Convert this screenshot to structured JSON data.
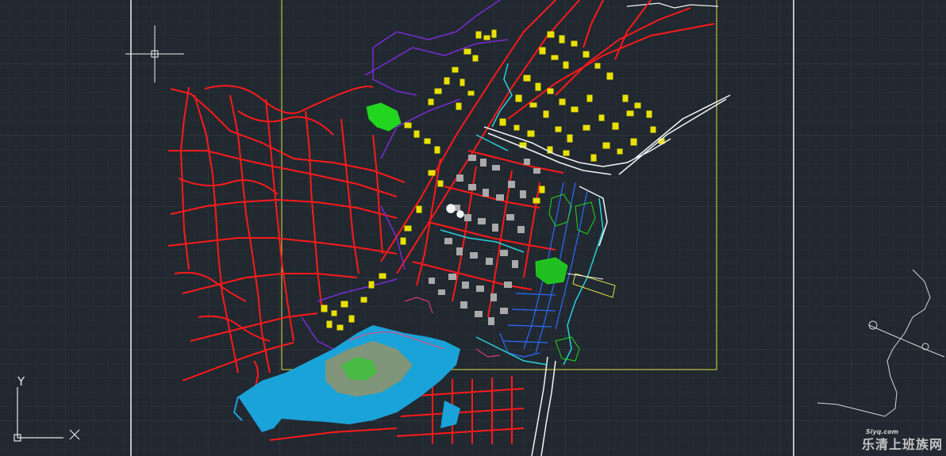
{
  "canvas": {
    "background": "#212830",
    "grid_major": "#2b333c",
    "grid_minor": "#262d35"
  },
  "layers": {
    "roads_color": "#ff0000",
    "district_color": "#7a2bd6",
    "buildings_color": "#ffff00",
    "blocks_color": "#b0b0b0",
    "water_color": "#18a6d6",
    "green_color": "#22d620",
    "sheet_frame_color": "#e0e040",
    "viewport_border_color": "#f2f2f2"
  },
  "ucs_icon": {
    "y_label": "Y",
    "x_marker": "×"
  },
  "crosshair_cursor": "crosshair-cursor",
  "watermark": {
    "text": "乐清上班族网",
    "logo": "Siyq.com"
  }
}
